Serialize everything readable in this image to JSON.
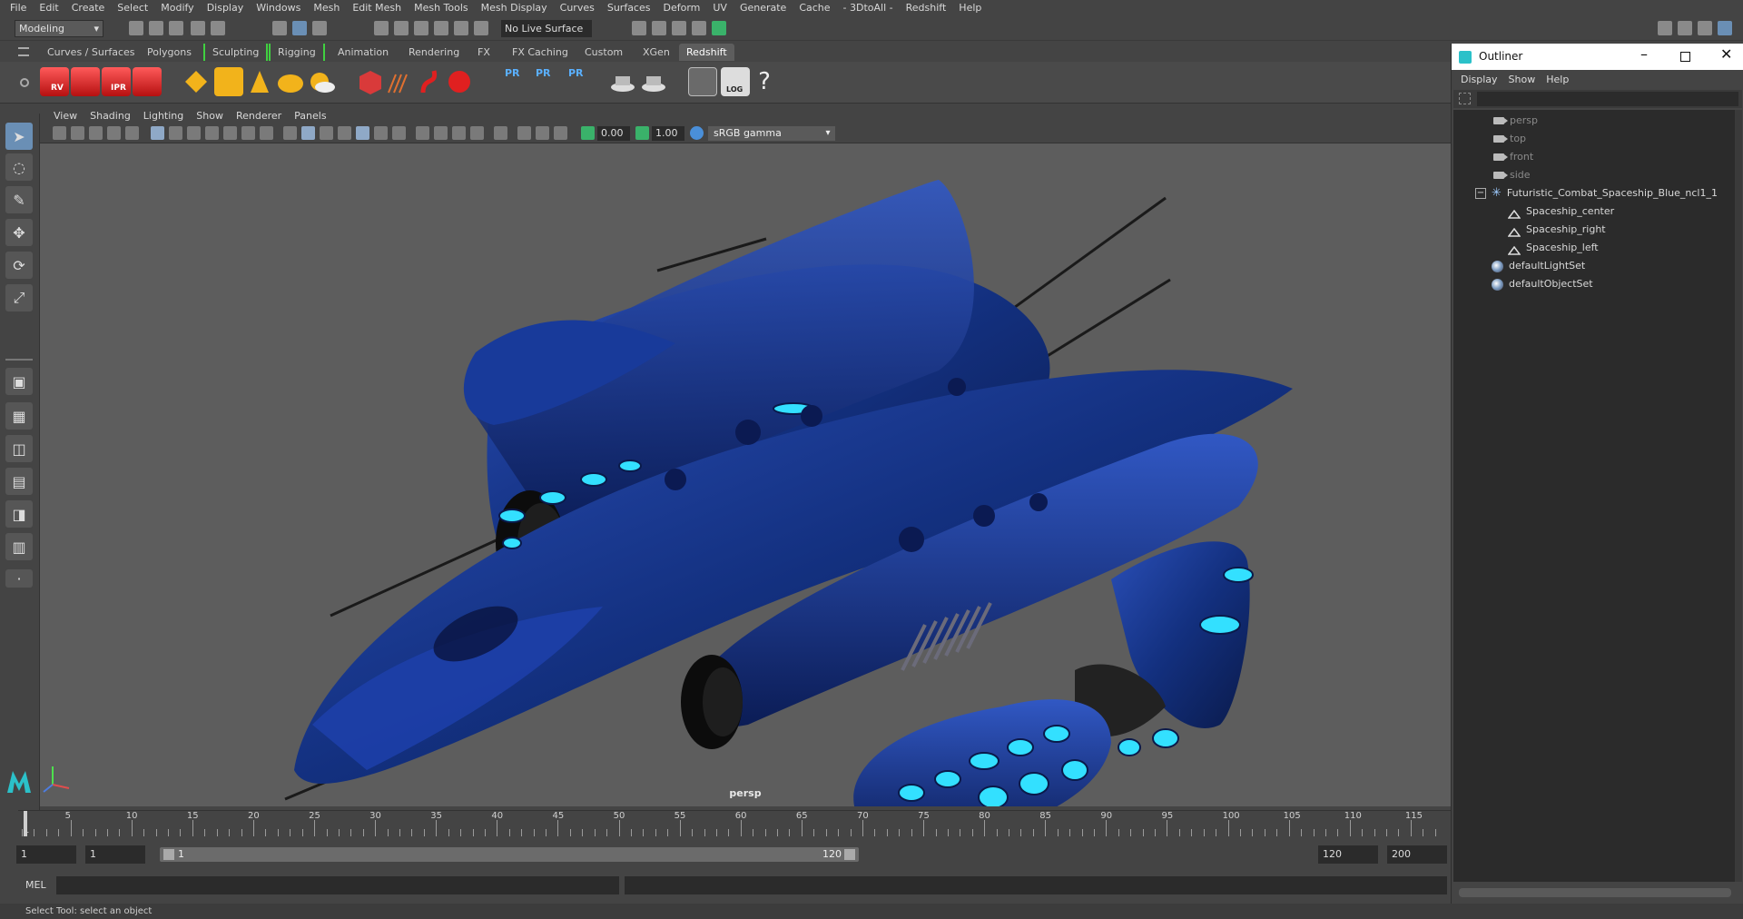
{
  "menubar": {
    "items": [
      "File",
      "Edit",
      "Create",
      "Select",
      "Modify",
      "Display",
      "Windows",
      "Mesh",
      "Edit Mesh",
      "Mesh Tools",
      "Mesh Display",
      "Curves",
      "Surfaces",
      "Deform",
      "UV",
      "Generate",
      "Cache",
      "- 3DtoAll -",
      "Redshift",
      "Help"
    ]
  },
  "statusline": {
    "mode": "Modeling",
    "live_surface": "No Live Surface"
  },
  "shelf": {
    "tabs": [
      "Curves / Surfaces",
      "Polygons",
      "Sculpting",
      "Rigging",
      "Animation",
      "Rendering",
      "FX",
      "FX Caching",
      "Custom",
      "XGen",
      "Redshift"
    ],
    "active_tab": "Redshift",
    "icon_labels": {
      "rv": "RV",
      "ipr": "IPR",
      "pr": "PR",
      "log": "LOG",
      "help": "?"
    }
  },
  "panel": {
    "menu": [
      "View",
      "Shading",
      "Lighting",
      "Show",
      "Renderer",
      "Panels"
    ],
    "exposure": "0.00",
    "gamma": "1.00",
    "color_space": "sRGB gamma",
    "camera_label": "persp"
  },
  "timeline": {
    "ticks": [
      "1",
      "5",
      "10",
      "15",
      "20",
      "25",
      "30",
      "35",
      "40",
      "45",
      "50",
      "55",
      "60",
      "65",
      "70",
      "75",
      "80",
      "85",
      "90",
      "95",
      "100",
      "105",
      "110",
      "115"
    ],
    "start_frame": "1",
    "current_frame": "1",
    "range_start": "1",
    "range_end_inner": "120",
    "range_end": "120",
    "end_frame": "200"
  },
  "cmdline": {
    "label": "MEL"
  },
  "helpline": {
    "text": "Select Tool: select an object"
  },
  "outliner": {
    "title": "Outliner",
    "menu": [
      "Display",
      "Show",
      "Help"
    ],
    "cameras": [
      "persp",
      "top",
      "front",
      "side"
    ],
    "group": "Futuristic_Combat_Spaceship_Blue_ncl1_1",
    "children": [
      "Spaceship_center",
      "Spaceship_right",
      "Spaceship_left"
    ],
    "sets": [
      "defaultLightSet",
      "defaultObjectSet"
    ]
  },
  "colors": {
    "ship_blue": "#12308a",
    "ship_glow": "#33e0ff",
    "viewport_bg": "#5d5d5d",
    "active_tab_bracket": "#40d040"
  }
}
